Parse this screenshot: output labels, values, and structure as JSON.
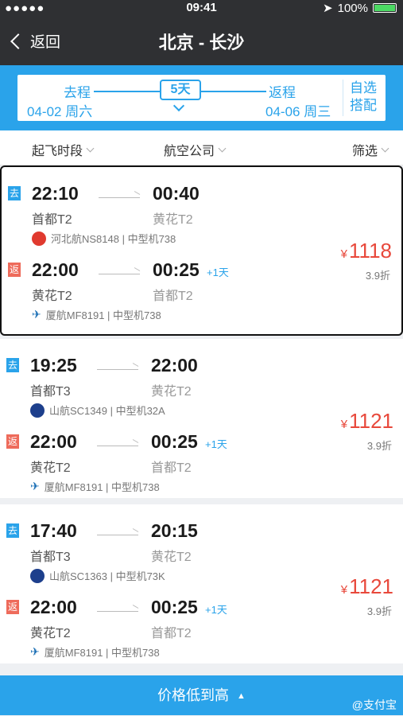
{
  "status": {
    "signal": "●●●●● ",
    "time": "09:41",
    "battery": "100%"
  },
  "nav": {
    "back": "返回",
    "title": "北京 - 长沙"
  },
  "dates": {
    "go_label": "去程",
    "go_date": "04-02 周六",
    "days": "5天",
    "back_label": "返程",
    "back_date": "04-06 周三",
    "custom": "自选搭配"
  },
  "filters": [
    {
      "label": "起飞时段"
    },
    {
      "label": "航空公司"
    },
    {
      "label": "筛选"
    }
  ],
  "flights": [
    {
      "price": "1118",
      "currency": "¥",
      "discount": "3.9折",
      "go": {
        "tag": "去",
        "dep": "22:10",
        "arr": "00:40",
        "dep_ap": "首都T2",
        "arr_ap": "黄花T2",
        "plus": "",
        "airline": "河北航NS8148 | 中型机738",
        "logo_color": "#e03a2f"
      },
      "ret": {
        "tag": "返",
        "dep": "22:00",
        "arr": "00:25",
        "dep_ap": "黄花T2",
        "arr_ap": "首都T2",
        "plus": "+1天",
        "airline": "厦航MF8191 | 中型机738",
        "logo_color": "#1b6fb5"
      }
    },
    {
      "price": "1121",
      "currency": "¥",
      "discount": "3.9折",
      "go": {
        "tag": "去",
        "dep": "19:25",
        "arr": "22:00",
        "dep_ap": "首都T3",
        "arr_ap": "黄花T2",
        "plus": "",
        "airline": "山航SC1349 | 中型机32A",
        "logo_color": "#1d3f8c"
      },
      "ret": {
        "tag": "返",
        "dep": "22:00",
        "arr": "00:25",
        "dep_ap": "黄花T2",
        "arr_ap": "首都T2",
        "plus": "+1天",
        "airline": "厦航MF8191 | 中型机738",
        "logo_color": "#1b6fb5"
      }
    },
    {
      "price": "1121",
      "currency": "¥",
      "discount": "3.9折",
      "go": {
        "tag": "去",
        "dep": "17:40",
        "arr": "20:15",
        "dep_ap": "首都T3",
        "arr_ap": "黄花T2",
        "plus": "",
        "airline": "山航SC1363 | 中型机73K",
        "logo_color": "#1d3f8c"
      },
      "ret": {
        "tag": "返",
        "dep": "22:00",
        "arr": "00:25",
        "dep_ap": "黄花T2",
        "arr_ap": "首都T2",
        "plus": "+1天",
        "airline": "厦航MF8191 | 中型机738",
        "logo_color": "#1b6fb5"
      }
    }
  ],
  "sort": {
    "label": "价格低到高"
  },
  "watermark": "@支付宝"
}
